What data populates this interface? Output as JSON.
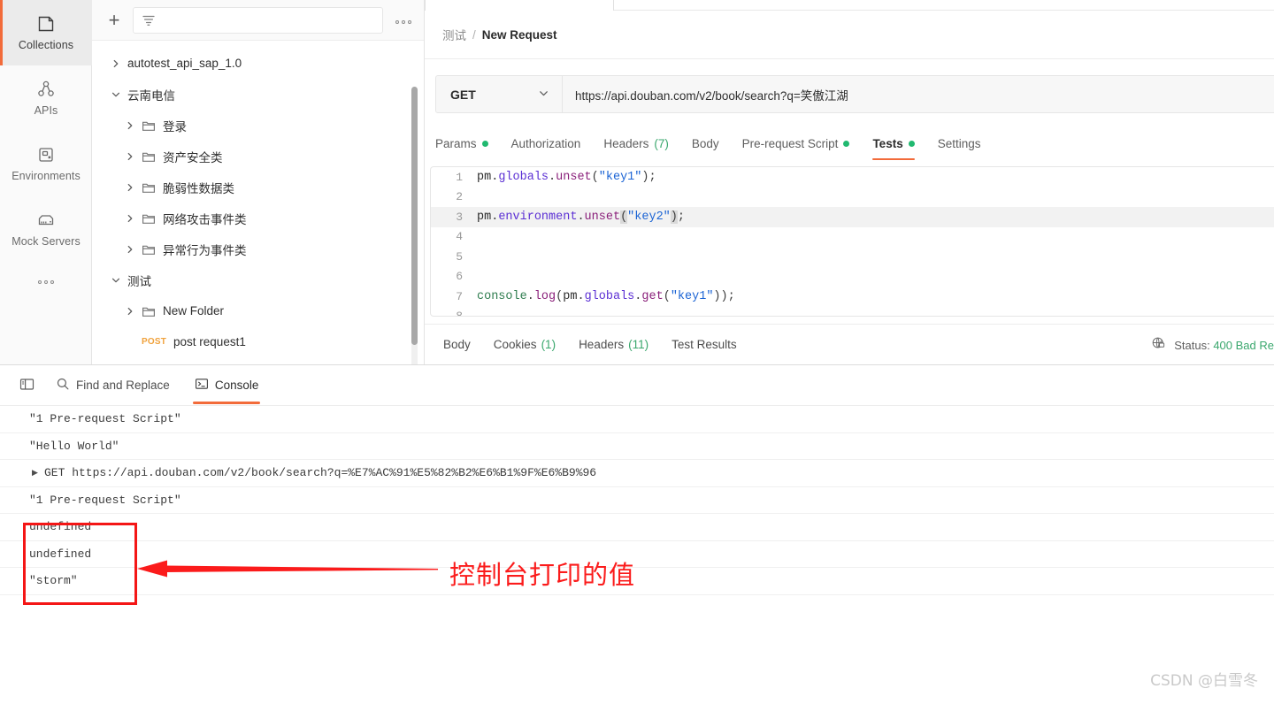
{
  "rail": {
    "items": [
      {
        "label": "Collections",
        "icon": "collections-icon",
        "active": true
      },
      {
        "label": "APIs",
        "icon": "apis-icon",
        "active": false
      },
      {
        "label": "Environments",
        "icon": "environments-icon",
        "active": false
      },
      {
        "label": "Mock Servers",
        "icon": "mock-servers-icon",
        "active": false
      }
    ],
    "more_label": "..."
  },
  "sidebar": {
    "add_label": "+",
    "search": {
      "value": "",
      "placeholder": ""
    },
    "more_label": "...",
    "tree": [
      {
        "label": "autotest_api_sap_1.0",
        "type": "collection",
        "depth": 0,
        "expanded": false
      },
      {
        "label": "云南电信",
        "type": "collection",
        "depth": 0,
        "expanded": true
      },
      {
        "label": "登录",
        "type": "folder",
        "depth": 1,
        "expanded": false
      },
      {
        "label": "资产安全类",
        "type": "folder",
        "depth": 1,
        "expanded": false
      },
      {
        "label": "脆弱性数据类",
        "type": "folder",
        "depth": 1,
        "expanded": false
      },
      {
        "label": "网络攻击事件类",
        "type": "folder",
        "depth": 1,
        "expanded": false
      },
      {
        "label": "异常行为事件类",
        "type": "folder",
        "depth": 1,
        "expanded": false
      },
      {
        "label": "测试",
        "type": "collection",
        "depth": 0,
        "expanded": true
      },
      {
        "label": "New Folder",
        "type": "folder",
        "depth": 1,
        "expanded": false
      },
      {
        "label": "post request1",
        "type": "request",
        "method": "POST",
        "depth": 1
      }
    ]
  },
  "request": {
    "breadcrumb": {
      "collection": "测试",
      "separator": "/",
      "name": "New Request"
    },
    "method": "GET",
    "url": "https://api.douban.com/v2/book/search?q=笑傲江湖",
    "tabs": [
      {
        "label": "Params",
        "dot": true,
        "active": false
      },
      {
        "label": "Authorization",
        "dot": false,
        "active": false
      },
      {
        "label": "Headers",
        "count": "(7)",
        "dot": false,
        "active": false
      },
      {
        "label": "Body",
        "dot": false,
        "active": false
      },
      {
        "label": "Pre-request Script",
        "dot": true,
        "active": false
      },
      {
        "label": "Tests",
        "dot": true,
        "active": true
      },
      {
        "label": "Settings",
        "dot": false,
        "active": false
      }
    ],
    "editor": {
      "lines": [
        {
          "n": "1",
          "text": "pm.globals.unset(\"key1\");"
        },
        {
          "n": "2",
          "text": ""
        },
        {
          "n": "3",
          "text": "pm.environment.unset(\"key2\");"
        },
        {
          "n": "4",
          "text": ""
        },
        {
          "n": "5",
          "text": ""
        },
        {
          "n": "6",
          "text": ""
        },
        {
          "n": "7",
          "text": "console.log(pm.globals.get(\"key1\"));"
        },
        {
          "n": "8",
          "text": ""
        }
      ]
    }
  },
  "response": {
    "tabs": [
      {
        "label": "Body",
        "count": "",
        "active": false
      },
      {
        "label": "Cookies",
        "count": "(1)",
        "active": false
      },
      {
        "label": "Headers",
        "count": "(11)",
        "active": false
      },
      {
        "label": "Test Results",
        "count": "",
        "active": false
      }
    ],
    "status_label": "Status:",
    "status_value": "400 Bad Re"
  },
  "console": {
    "toolbar": [
      {
        "label": "",
        "icon": "sidebar-toggle-icon",
        "active": false
      },
      {
        "label": "Find and Replace",
        "icon": "search-icon",
        "active": false
      },
      {
        "label": "Console",
        "icon": "console-icon",
        "active": true
      }
    ],
    "logs": [
      {
        "text": "\"1 Pre-request Script\"",
        "caret": false
      },
      {
        "text": "\"Hello World\"",
        "caret": false
      },
      {
        "text": "GET https://api.douban.com/v2/book/search?q=%E7%AC%91%E5%82%B2%E6%B1%9F%E6%B9%96",
        "caret": true
      },
      {
        "text": "\"1 Pre-request Script\"",
        "caret": false
      },
      {
        "text": "undefined",
        "caret": false
      },
      {
        "text": "undefined",
        "caret": false
      },
      {
        "text": "\"storm\"",
        "caret": false
      }
    ]
  },
  "annotation": {
    "note": "控制台打印的值",
    "color": "#fb1b1b"
  },
  "watermark": "CSDN @白雪冬",
  "colors": {
    "accent": "#f26b3a",
    "green": "#21b970",
    "method_post": "#f0a23c",
    "annotation_red": "#fb1b1b"
  }
}
